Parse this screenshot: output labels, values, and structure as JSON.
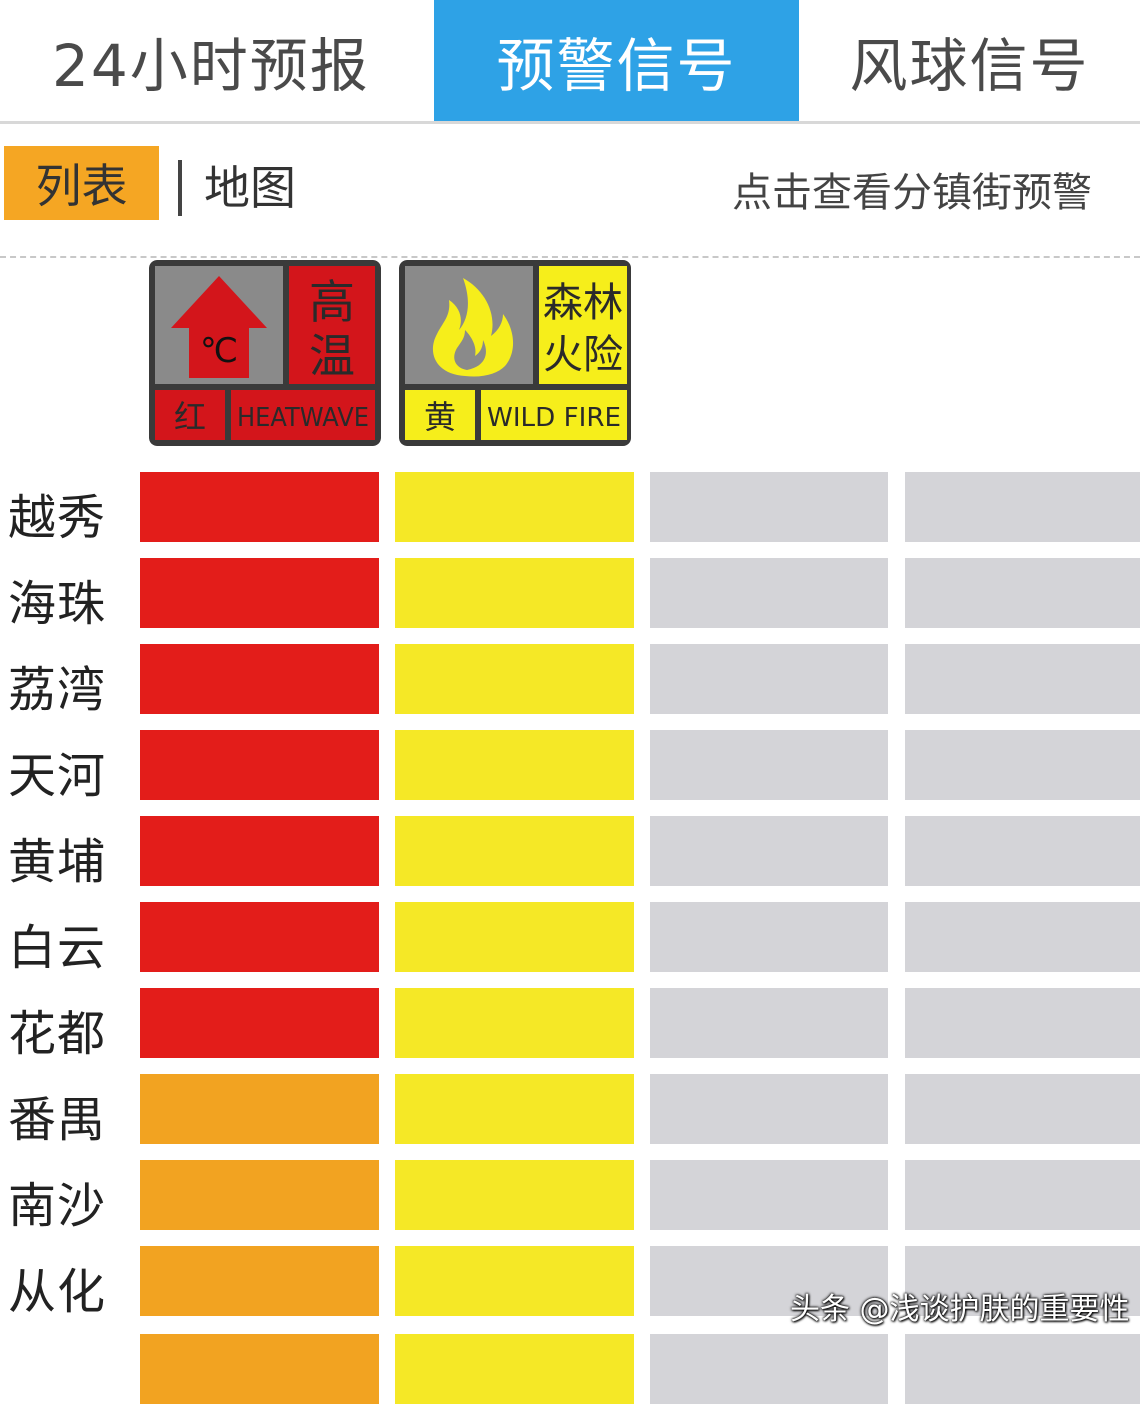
{
  "tabs": [
    {
      "label": "24小时预报",
      "active": false
    },
    {
      "label": "预警信号",
      "active": true
    },
    {
      "label": "风球信号",
      "active": false
    }
  ],
  "view": {
    "list_label": "列表",
    "map_label": "地图",
    "hint": "点击查看分镇街预警"
  },
  "icons": {
    "heat": {
      "name": "高温",
      "level": "红",
      "english": "HEATWAVE",
      "symbol": "℃",
      "color": "#d3151b"
    },
    "fire": {
      "name_line1": "森林",
      "name_line2": "火险",
      "level": "黄",
      "english": "WILD FIRE",
      "color": "#f6ee1b"
    }
  },
  "colors": {
    "red": "#e31d1a",
    "orange": "#f2a321",
    "yellow": "#f5e826",
    "gray": "#d4d4d8"
  },
  "rows": [
    {
      "district": "越秀",
      "levels": [
        "red",
        "yellow",
        "gray",
        "gray"
      ]
    },
    {
      "district": "海珠",
      "levels": [
        "red",
        "yellow",
        "gray",
        "gray"
      ]
    },
    {
      "district": "荔湾",
      "levels": [
        "red",
        "yellow",
        "gray",
        "gray"
      ]
    },
    {
      "district": "天河",
      "levels": [
        "red",
        "yellow",
        "gray",
        "gray"
      ]
    },
    {
      "district": "黄埔",
      "levels": [
        "red",
        "yellow",
        "gray",
        "gray"
      ]
    },
    {
      "district": "白云",
      "levels": [
        "red",
        "yellow",
        "gray",
        "gray"
      ]
    },
    {
      "district": "花都",
      "levels": [
        "red",
        "yellow",
        "gray",
        "gray"
      ]
    },
    {
      "district": "番禺",
      "levels": [
        "orange",
        "yellow",
        "gray",
        "gray"
      ]
    },
    {
      "district": "南沙",
      "levels": [
        "orange",
        "yellow",
        "gray",
        "gray"
      ]
    },
    {
      "district": "从化",
      "levels": [
        "orange",
        "yellow",
        "gray",
        "gray"
      ]
    },
    {
      "district": "",
      "levels": [
        "orange",
        "yellow",
        "gray",
        "gray"
      ]
    }
  ],
  "watermark": "头条 @浅谈护肤的重要性"
}
